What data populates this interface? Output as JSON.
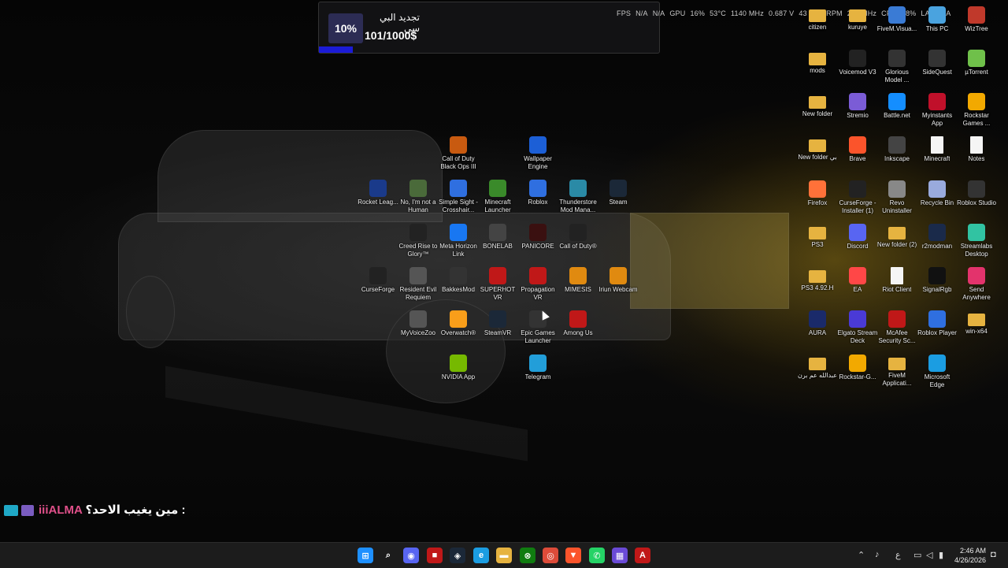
{
  "progress_widget": {
    "percent_label": "10%",
    "title": "تجديد البي سي",
    "amount": "101/1000$",
    "progress": 0.1
  },
  "hw_overlay": [
    "FPS",
    "N/A",
    "N/A",
    "GPU",
    "16%",
    "53°C",
    "1140 MHz",
    "0.687 V",
    "43",
    "076 RPM",
    "200 MHz",
    "CPU",
    "48%",
    "LAT",
    "N/A"
  ],
  "desktop_icons": [
    {
      "label": "citizen",
      "icon": "folder-icon",
      "color": "#e6b340"
    },
    {
      "label": "kuruye",
      "icon": "folder-icon",
      "color": "#e6b340"
    },
    {
      "label": "FiveM.Visua...",
      "icon": "app-icon",
      "color": "#3a7bd5"
    },
    {
      "label": "This PC",
      "icon": "monitor-icon",
      "color": "#4aa3df"
    },
    {
      "label": "WizTree",
      "icon": "app-icon",
      "color": "#c0392b"
    },
    {
      "label": "mods",
      "icon": "folder-icon",
      "color": "#e6b340"
    },
    {
      "label": "Voicemod V3",
      "icon": "app-icon",
      "color": "#222"
    },
    {
      "label": "Glorious Model ...",
      "icon": "mouse-icon",
      "color": "#333"
    },
    {
      "label": "SideQuest",
      "icon": "app-icon",
      "color": "#333"
    },
    {
      "label": "µTorrent",
      "icon": "app-icon",
      "color": "#6fc04a"
    },
    {
      "label": "New folder",
      "icon": "folder-icon",
      "color": "#e6b340"
    },
    {
      "label": "Stremio",
      "icon": "app-icon",
      "color": "#7b5cd6"
    },
    {
      "label": "Battle.net",
      "icon": "app-icon",
      "color": "#148eff"
    },
    {
      "label": "Myinstants App",
      "icon": "app-icon",
      "color": "#c0102a"
    },
    {
      "label": "Rockstar Games ...",
      "icon": "app-icon",
      "color": "#f2a900"
    },
    {
      "label": "New folder بي",
      "icon": "folder-icon",
      "color": "#e6b340"
    },
    {
      "label": "Brave",
      "icon": "brave-icon",
      "color": "#fb542b"
    },
    {
      "label": "Inkscape",
      "icon": "app-icon",
      "color": "#444"
    },
    {
      "label": "Minecraft",
      "icon": "doc-icon",
      "color": "#f5f5f5"
    },
    {
      "label": "Notes",
      "icon": "doc-icon",
      "color": "#f5f5f5"
    },
    {
      "label": "Firefox",
      "icon": "firefox-icon",
      "color": "#ff7139"
    },
    {
      "label": "CurseForge - Installer (1)",
      "icon": "app-icon",
      "color": "#222"
    },
    {
      "label": "Revo Uninstaller",
      "icon": "app-icon",
      "color": "#888"
    },
    {
      "label": "Recycle Bin",
      "icon": "recycle-bin-icon",
      "color": "#9ad"
    },
    {
      "label": "Roblox Studio",
      "icon": "app-icon",
      "color": "#333"
    },
    {
      "label": "PS3",
      "icon": "folder-icon",
      "color": "#e6b340"
    },
    {
      "label": "Discord",
      "icon": "discord-icon",
      "color": "#5865f2"
    },
    {
      "label": "New folder (2)",
      "icon": "folder-icon",
      "color": "#e6b340"
    },
    {
      "label": "r2modman",
      "icon": "app-icon",
      "color": "#1a2a4a"
    },
    {
      "label": "Streamlabs Desktop",
      "icon": "app-icon",
      "color": "#31c3a2"
    },
    {
      "label": "PS3 4.92.H",
      "icon": "folder-icon",
      "color": "#e6b340"
    },
    {
      "label": "EA",
      "icon": "app-icon",
      "color": "#ff4747"
    },
    {
      "label": "Riot Client",
      "icon": "doc-icon",
      "color": "#f5f5f5"
    },
    {
      "label": "SignalRgb",
      "icon": "app-icon",
      "color": "#111"
    },
    {
      "label": "Send Anywhere",
      "icon": "app-icon",
      "color": "#e3336c"
    },
    {
      "label": "AURA",
      "icon": "app-icon",
      "color": "#1a2a6a"
    },
    {
      "label": "Elgato Stream Deck",
      "icon": "app-icon",
      "color": "#4a3ad6"
    },
    {
      "label": "McAfee Security Sc...",
      "icon": "app-icon",
      "color": "#c01818"
    },
    {
      "label": "Roblox Player",
      "icon": "app-icon",
      "color": "#2f6fe0"
    },
    {
      "label": "win-x64",
      "icon": "folder-icon",
      "color": "#e6b340"
    },
    {
      "label": "عبدالله عم برن",
      "icon": "folder-icon",
      "color": "#e6b340"
    },
    {
      "label": "Rockstar-G...",
      "icon": "app-icon",
      "color": "#f2a900"
    },
    {
      "label": "FiveM Applicati...",
      "icon": "folder-icon",
      "color": "#e6b340"
    },
    {
      "label": "Microsoft Edge",
      "icon": "edge-icon",
      "color": "#1b9de2"
    },
    {
      "label": "Call of Duty Black Ops III",
      "icon": "app-icon",
      "color": "#c85a10"
    },
    {
      "label": "Wallpaper Engine",
      "icon": "app-icon",
      "color": "#1c5fd6"
    },
    {
      "label": "Rocket Leag...",
      "icon": "app-icon",
      "color": "#1a3a8a"
    },
    {
      "label": "No, I'm not a Human",
      "icon": "app-icon",
      "color": "#4a6a3a"
    },
    {
      "label": "Simple Sight - Crosshair...",
      "icon": "app-icon",
      "color": "#2f6fe0"
    },
    {
      "label": "Minecraft Launcher",
      "icon": "app-icon",
      "color": "#3a8a2a"
    },
    {
      "label": "Roblox",
      "icon": "app-icon",
      "color": "#2f6fe0"
    },
    {
      "label": "Thunderstore Mod Mana...",
      "icon": "app-icon",
      "color": "#2a8aa6"
    },
    {
      "label": "Steam",
      "icon": "steam-icon",
      "color": "#1b2838"
    },
    {
      "label": "Creed Rise to Glory™",
      "icon": "app-icon",
      "color": "#222"
    },
    {
      "label": "Meta Horizon Link",
      "icon": "app-icon",
      "color": "#1877f2"
    },
    {
      "label": "BONELAB",
      "icon": "app-icon",
      "color": "#444"
    },
    {
      "label": "PANICORE",
      "icon": "app-icon",
      "color": "#3a1010"
    },
    {
      "label": "Call of Duty®",
      "icon": "app-icon",
      "color": "#222"
    },
    {
      "label": "CurseForge",
      "icon": "app-icon",
      "color": "#222"
    },
    {
      "label": "Resident Evil Requiem",
      "icon": "app-icon",
      "color": "#555"
    },
    {
      "label": "BakkesMod",
      "icon": "app-icon",
      "color": "#333"
    },
    {
      "label": "SUPERHOT VR",
      "icon": "app-icon",
      "color": "#c01818"
    },
    {
      "label": "Propagation VR",
      "icon": "app-icon",
      "color": "#c01818"
    },
    {
      "label": "MIMESIS",
      "icon": "app-icon",
      "color": "#e08a10"
    },
    {
      "label": "Iriun Webcam",
      "icon": "app-icon",
      "color": "#e08a10"
    },
    {
      "label": "MyVoiceZoo",
      "icon": "app-icon",
      "color": "#555"
    },
    {
      "label": "Overwatch®",
      "icon": "app-icon",
      "color": "#f99e1a"
    },
    {
      "label": "SteamVR",
      "icon": "app-icon",
      "color": "#1b2838"
    },
    {
      "label": "Epic Games Launcher",
      "icon": "app-icon",
      "color": "#333"
    },
    {
      "label": "Among Us",
      "icon": "app-icon",
      "color": "#c01818"
    },
    {
      "label": "NVIDIA App",
      "icon": "nvidia-icon",
      "color": "#76b900"
    },
    {
      "label": "Telegram",
      "icon": "telegram-icon",
      "color": "#229ed9"
    }
  ],
  "chat": {
    "user": "iiiALMA",
    "message": "مين يغيب الاحد؟ :"
  },
  "taskbar": {
    "apps": [
      {
        "name": "windows-start-icon",
        "color": "#1e90ff",
        "glyph": "⊞"
      },
      {
        "name": "search-icon",
        "color": "transparent",
        "glyph": "⌕"
      },
      {
        "name": "discord-icon",
        "color": "#5865f2",
        "glyph": "◉"
      },
      {
        "name": "app-icon",
        "color": "#c01818",
        "glyph": "■"
      },
      {
        "name": "steam-icon",
        "color": "#1b2838",
        "glyph": "◈"
      },
      {
        "name": "edge-icon",
        "color": "#1b9de2",
        "glyph": "e"
      },
      {
        "name": "file-explorer-icon",
        "color": "#e6b340",
        "glyph": "▬"
      },
      {
        "name": "xbox-icon",
        "color": "#107c10",
        "glyph": "⊗"
      },
      {
        "name": "chrome-icon",
        "color": "#dd4b39",
        "glyph": "◎"
      },
      {
        "name": "brave-icon",
        "color": "#fb542b",
        "glyph": "▼"
      },
      {
        "name": "whatsapp-icon",
        "color": "#25d366",
        "glyph": "✆"
      },
      {
        "name": "app-grid-icon",
        "color": "#6a4ad6",
        "glyph": "▦"
      },
      {
        "name": "adobe-icon",
        "color": "#c01818",
        "glyph": "A"
      }
    ],
    "tray_lang": "ع",
    "time": "2:46 AM",
    "date": "4/26/2026"
  }
}
